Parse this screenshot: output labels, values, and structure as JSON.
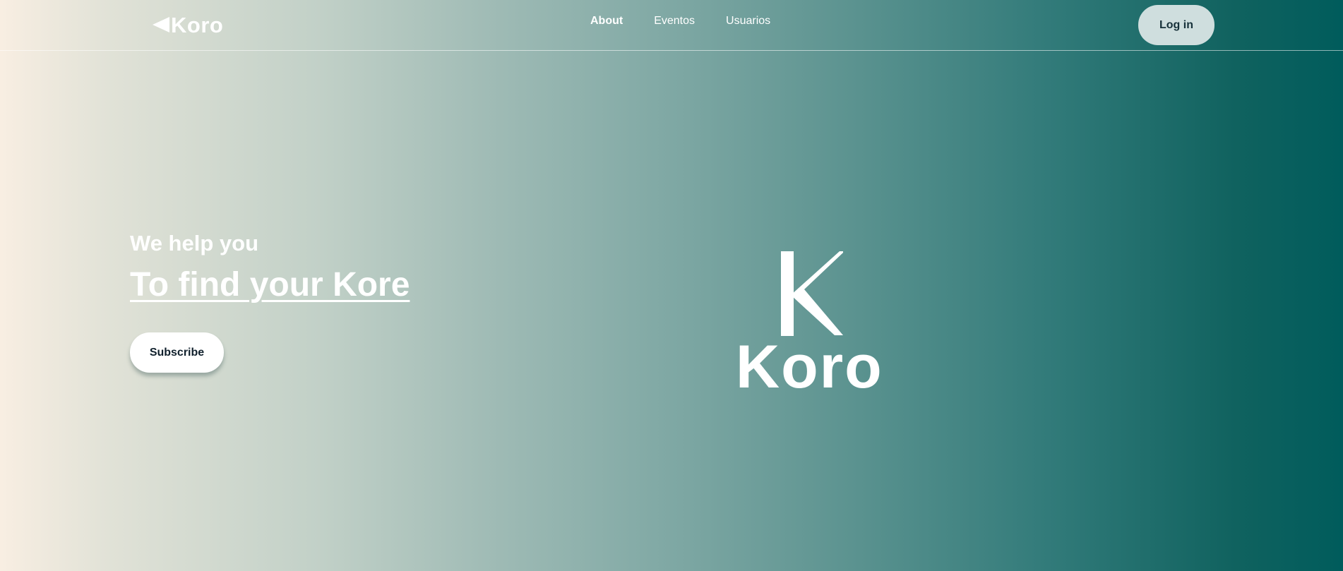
{
  "header": {
    "brand": "Koro",
    "nav": [
      {
        "label": "About",
        "active": true
      },
      {
        "label": "Eventos",
        "active": false
      },
      {
        "label": "Usuarios",
        "active": false
      }
    ],
    "login_label": "Log in"
  },
  "hero": {
    "eyebrow": "We help you",
    "headline": "To find your Kore",
    "subscribe_label": "Subscribe",
    "logo_text": "Koro"
  },
  "icons": {
    "brand": "triangle-left-icon",
    "hero_logo": "koro-k-logo-icon"
  },
  "colors": {
    "gradient_left": "#f8eee2",
    "gradient_right": "#005c5c",
    "login_button": "#cfdede",
    "text_dark": "#17313a",
    "white": "#ffffff"
  }
}
